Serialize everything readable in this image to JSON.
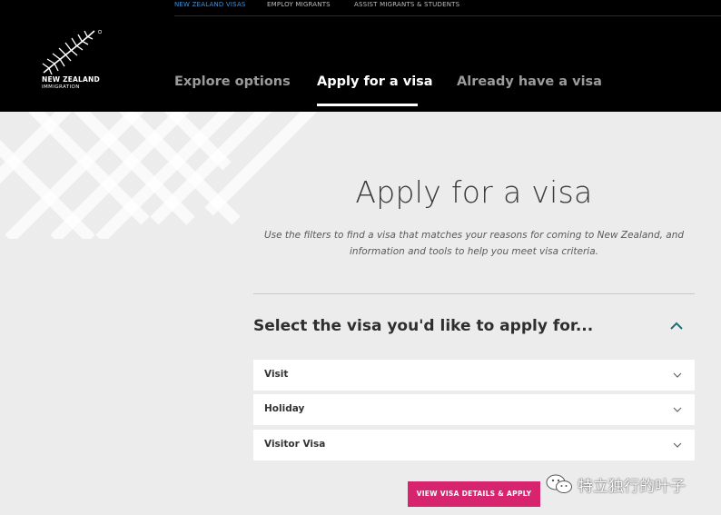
{
  "util_nav": {
    "items": [
      "NEW ZEALAND VISAS",
      "EMPLOY MIGRANTS",
      "ASSIST MIGRANTS & STUDENTS"
    ],
    "active_index": 0
  },
  "logo": {
    "name": "NEW ZEALAND",
    "sub": "IMMIGRATION",
    "icon": "silver-fern-icon"
  },
  "main_nav": {
    "tabs": [
      "Explore options",
      "Apply for a visa",
      "Already have a visa"
    ],
    "active_index": 1
  },
  "hero": {
    "title": "Apply for a visa",
    "description_line1": "Use the filters to find a visa that matches your reasons for coming to New Zealand, and",
    "description_line2": "information and tools to help you meet visa criteria."
  },
  "selector": {
    "heading": "Select the visa you'd like to apply for...",
    "toggle_icon": "chevron-up-icon",
    "options": [
      {
        "label": "Visit",
        "icon": "chevron-down-icon"
      },
      {
        "label": "Holiday",
        "icon": "chevron-down-icon"
      },
      {
        "label": "Visitor Visa",
        "icon": "chevron-down-icon"
      }
    ],
    "button_label": "VIEW VISA DETAILS & APPLY"
  },
  "watermark": {
    "text": "特立独行的叶子",
    "icon": "wechat-icon"
  },
  "colors": {
    "header_bg": "#000000",
    "active_util_link": "#3f8fd6",
    "accent_teal": "#1d6f7a",
    "button_pink": "#d6246e",
    "page_bg": "#ececec"
  }
}
